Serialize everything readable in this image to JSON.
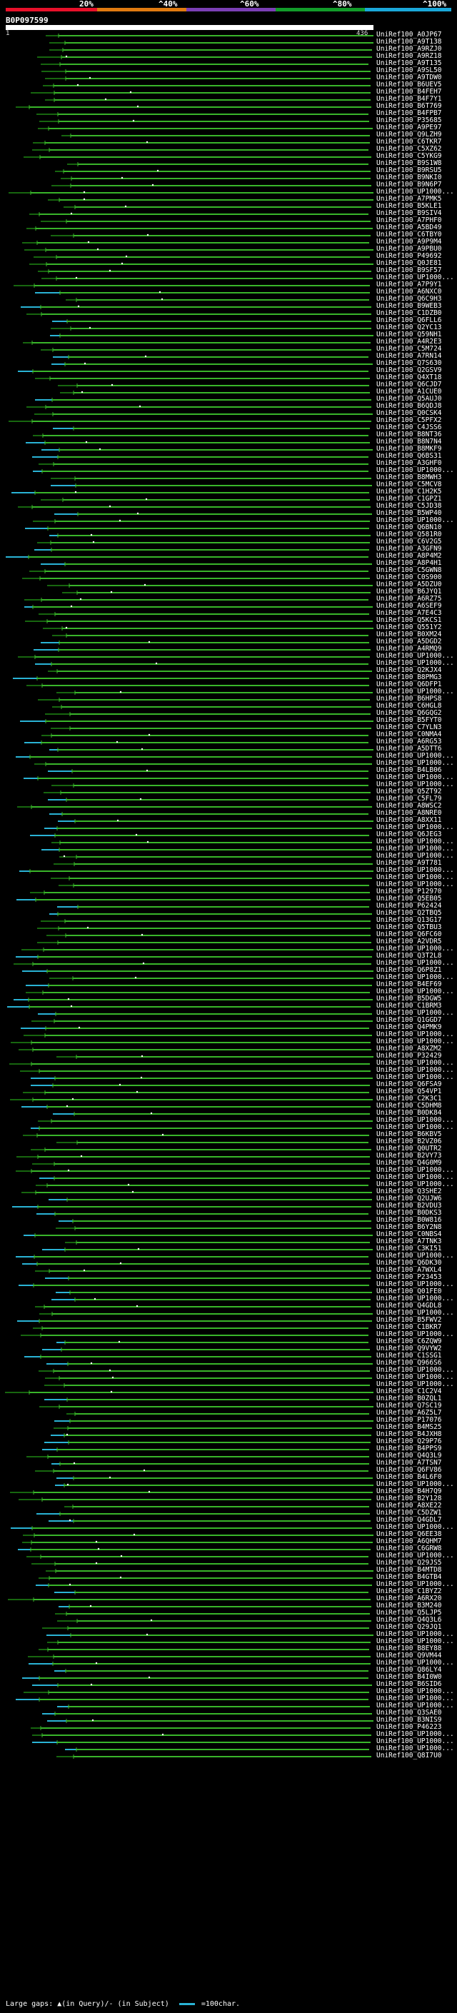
{
  "scale": {
    "labels": [
      "20%",
      "^40%",
      "^60%",
      "^80%",
      "^100%"
    ],
    "colors": [
      "#e8102a",
      "#e07a10",
      "#7b3fb5",
      "#129c2a",
      "#1aa7d9"
    ]
  },
  "query": {
    "id": "B0P097599",
    "range_start": "1",
    "range_end": "436"
  },
  "colors": {
    "match": "#39b52a",
    "match_dark": "#17660f",
    "insert": "#2ab3d5",
    "gap_dot": "#ffffff",
    "background": "#000000"
  },
  "hits": [
    "UniRef100_A0JP67",
    "UniRef100_A9T138",
    "UniRef100_A9RZJ0",
    "UniRef100_A9RZ18",
    "UniRef100_A9T135",
    "UniRef100_A9SL50",
    "UniRef100_A9TDW0",
    "UniRef100_B6UEV5",
    "UniRef100_B4FEH7",
    "UniRef100_B4F7Y1",
    "UniRef100_B6T769",
    "UniRef100_B4FPB7",
    "UniRef100_P35685",
    "UniRef100_A9PE97",
    "UniRef100_Q9LZH9",
    "UniRef100_C6TKR7",
    "UniRef100_C5XZ62",
    "UniRef100_C5YKG9",
    "UniRef100_B9S1W8",
    "UniRef100_B9RSU5",
    "UniRef100_B9NKI0",
    "UniRef100_B9N6P7",
    "UniRef100_UP1000...",
    "UniRef100_A7PMK5",
    "UniRef100_B5KLE1",
    "UniRef100_B9SIV4",
    "UniRef100_A7PHF0",
    "UniRef100_A5BD49",
    "UniRef100_C6TBY0",
    "UniRef100_A9P9M4",
    "UniRef100_A9PBU0",
    "UniRef100_P49692",
    "UniRef100_Q0JE81",
    "UniRef100_B9SF57",
    "UniRef100_UP1000...",
    "UniRef100_A7P9Y1",
    "UniRef100_A6NXC0",
    "UniRef100_Q6C9H3",
    "UniRef100_B9WEB3",
    "UniRef100_C1DZB0",
    "UniRef100_Q6FLL6",
    "UniRef100_Q2YC13",
    "UniRef100_Q59NH1",
    "UniRef100_A4R2E3",
    "UniRef100_C5M724",
    "UniRef100_A7RN14",
    "UniRef100_Q7S630",
    "UniRef100_Q2GSV9",
    "UniRef100_Q4XT18",
    "UniRef100_Q6CJD7",
    "UniRef100_A1CUE0",
    "UniRef100_Q5AUJ0",
    "UniRef100_B6QDJ8",
    "UniRef100_Q0CSK4",
    "UniRef100_C5PFX2",
    "UniRef100_C4JSS6",
    "UniRef100_B8NT36",
    "UniRef100_B8N7N4",
    "UniRef100_B8MKF9",
    "UniRef100_Q6BS31",
    "UniRef100_A3GHF0",
    "UniRef100_UP1000...",
    "UniRef100_B8MWH3",
    "UniRef100_C5MCV8",
    "UniRef100_C1H2K5",
    "UniRef100_C1GPZ1",
    "UniRef100_C5JD38",
    "UniRef100_B5WP40",
    "UniRef100_UP1000...",
    "UniRef100_Q6BN10",
    "UniRef100_Q581R0",
    "UniRef100_C6V2G5",
    "UniRef100_A3GFN9",
    "UniRef100_A8P4M2",
    "UniRef100_A8P4H1",
    "UniRef100_C5GWN8",
    "UniRef100_C0S900",
    "UniRef100_A5DZU0",
    "UniRef100_B6JYQ1",
    "UniRef100_A6RZ75",
    "UniRef100_A6SEF9",
    "UniRef100_A7E4C3",
    "UniRef100_Q5KCS1",
    "UniRef100_Q551Y2",
    "UniRef100_B0XM24",
    "UniRef100_A5DGD2",
    "UniRef100_A4RMQ9",
    "UniRef100_UP1000...",
    "UniRef100_UP1000...",
    "UniRef100_Q2KJX4",
    "UniRef100_B8PMG3",
    "UniRef100_Q6DFP1",
    "UniRef100_UP1000...",
    "UniRef100_B6HPS8",
    "UniRef100_C6HGL8",
    "UniRef100_Q6GQG2",
    "UniRef100_B5FYT0",
    "UniRef100_C7YLN3",
    "UniRef100_C0NMA4",
    "UniRef100_A6RG53",
    "UniRef100_A5DTT6",
    "UniRef100_UP1000...",
    "UniRef100_UP1000...",
    "UniRef100_B4LB06",
    "UniRef100_UP1000...",
    "UniRef100_UP1000...",
    "UniRef100_Q5ZT92",
    "UniRef100_C5FL79",
    "UniRef100_A8WSC2",
    "UniRef100_A8NRE0",
    "UniRef100_A8XX11",
    "UniRef100_UP1000...",
    "UniRef100_Q6JEG3",
    "UniRef100_UP1000...",
    "UniRef100_UP1000...",
    "UniRef100_UP1000...",
    "UniRef100_A9T781",
    "UniRef100_UP1000...",
    "UniRef100_UP1000...",
    "UniRef100_UP1000...",
    "UniRef100_P12970",
    "UniRef100_Q5EB05",
    "UniRef100_P62424",
    "UniRef100_Q2TBQ5",
    "UniRef100_Q13G17",
    "UniRef100_Q5TBU3",
    "UniRef100_Q6FC60",
    "UniRef100_A2VDR5",
    "UniRef100_UP1000...",
    "UniRef100_Q3T2L8",
    "UniRef100_UP1000...",
    "UniRef100_Q6P8Z1",
    "UniRef100_UP1000...",
    "UniRef100_B4EF69",
    "UniRef100_UP1000...",
    "UniRef100_B5DGW5",
    "UniRef100_C1BRM3",
    "UniRef100_UP1000...",
    "UniRef100_Q1GGD7",
    "UniRef100_Q4PMK9",
    "UniRef100_UP1000...",
    "UniRef100_UP1000...",
    "UniRef100_A8XZM2",
    "UniRef100_P32429",
    "UniRef100_UP1000...",
    "UniRef100_UP1000...",
    "UniRef100_UP1000...",
    "UniRef100_Q6FSA9",
    "UniRef100_Q54VP1",
    "UniRef100_C2K3C1",
    "UniRef100_C5DHM8",
    "UniRef100_B0DK84",
    "UniRef100_UP1000...",
    "UniRef100_UP1000...",
    "UniRef100_B6KBV5",
    "UniRef100_B2VZ06",
    "UniRef100_Q0UTR2",
    "UniRef100_B2VY73",
    "UniRef100_Q4G0M9",
    "UniRef100_UP1000...",
    "UniRef100_UP1000...",
    "UniRef100_UP1000...",
    "UniRef100_Q3SHE2",
    "UniRef100_Q2UJW6",
    "UniRef100_B2VDU3",
    "UniRef100_B0DKS3",
    "UniRef100_B0W816",
    "UniRef100_B6Y2N8",
    "UniRef100_C0NBS4",
    "UniRef100_A7TNK3",
    "UniRef100_C3KI51",
    "UniRef100_UP1000...",
    "UniRef100_Q6DK30",
    "UniRef100_A7WXL4",
    "UniRef100_P23453",
    "UniRef100_UP1000...",
    "UniRef100_Q01FE0",
    "UniRef100_UP1000...",
    "UniRef100_Q4GDL8",
    "UniRef100_UP1000...",
    "UniRef100_B5FWV2",
    "UniRef100_C1BKR7",
    "UniRef100_UP1000...",
    "UniRef100_C6ZQW9",
    "UniRef100_Q9VYW2",
    "UniRef100_C1SSG1",
    "UniRef100_Q966S6",
    "UniRef100_UP1000...",
    "UniRef100_UP1000...",
    "UniRef100_UP1000...",
    "UniRef100_C1C2V4",
    "UniRef100_B0ZQL1",
    "UniRef100_Q7SC19",
    "UniRef100_A6Z5L7",
    "UniRef100_P17076",
    "UniRef100_B4MS25",
    "UniRef100_B4JXH8",
    "UniRef100_Q29P76",
    "UniRef100_B4PPS9",
    "UniRef100_Q4Q3L9",
    "UniRef100_A7TSN7",
    "UniRef100_Q6FV86",
    "UniRef100_B4L6F0",
    "UniRef100_UP1000...",
    "UniRef100_B4H7Q9",
    "UniRef100_B2Y128",
    "UniRef100_A8XE22",
    "UniRef100_C5DZW1",
    "UniRef100_Q4GDL7",
    "UniRef100_UP1000...",
    "UniRef100_Q6EE38",
    "UniRef100_A6QHM7",
    "UniRef100_C6GRW8",
    "UniRef100_UP1000...",
    "UniRef100_Q29JS5",
    "UniRef100_B4MTD8",
    "UniRef100_B4GTB4",
    "UniRef100_UP1000...",
    "UniRef100_C1BYZ2",
    "UniRef100_A6RX20",
    "UniRef100_B3M240",
    "UniRef100_Q5LJP5",
    "UniRef100_Q4Q3L6",
    "UniRef100_Q29JQ1",
    "UniRef100_UP1000...",
    "UniRef100_UP1000...",
    "UniRef100_B8EY88",
    "UniRef100_Q9VM44",
    "UniRef100_UP1000...",
    "UniRef100_Q86LY4",
    "UniRef100_B4I0W0",
    "UniRef100_B6SID6",
    "UniRef100_UP1000...",
    "UniRef100_UP1000...",
    "UniRef100_UP1000...",
    "UniRef100_Q3SAE0",
    "UniRef100_B3NIS9",
    "UniRef100_P46223",
    "UniRef100_UP1000...",
    "UniRef100_UP1000...",
    "UniRef100_UP1000...",
    "UniRef100_Q8I7U0"
  ],
  "footer": {
    "gaps_text": "Large gaps: ▲(in Query)/- (in Subject)",
    "scale_text": "=100char."
  }
}
